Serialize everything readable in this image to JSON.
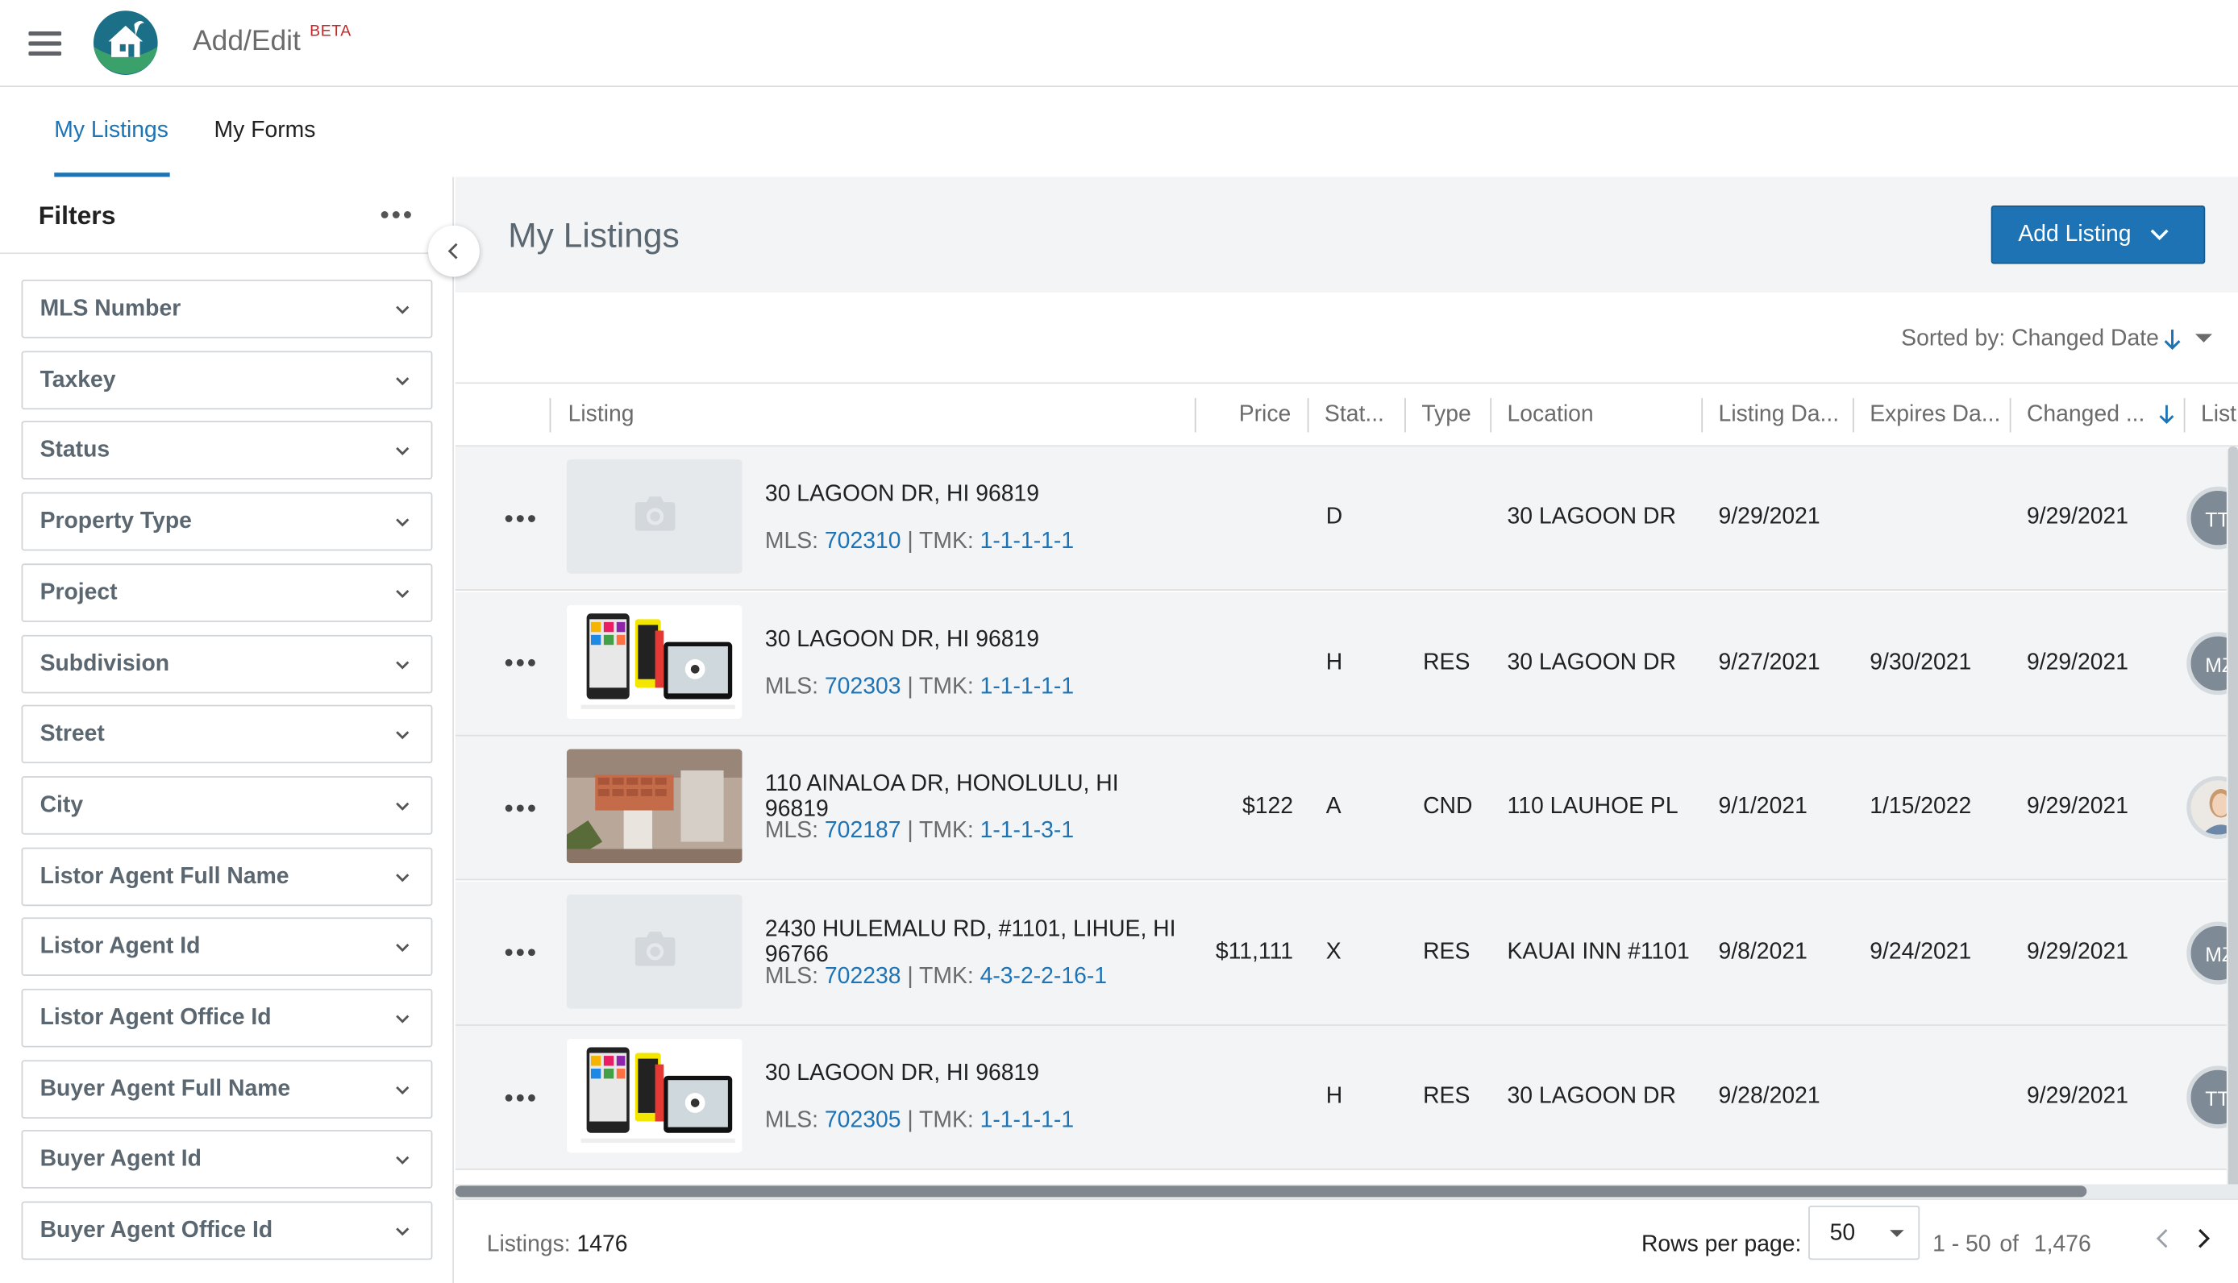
{
  "app": {
    "title": "Add/Edit",
    "badge": "BETA",
    "logo_icon": "house-globe-logo",
    "menu_icon": "hamburger-menu-icon"
  },
  "tabs": [
    {
      "label": "My Listings",
      "active": true
    },
    {
      "label": "My Forms",
      "active": false
    }
  ],
  "sidebar": {
    "title": "Filters",
    "filters": [
      "MLS Number",
      "Taxkey",
      "Status",
      "Property Type",
      "Project",
      "Subdivision",
      "Street",
      "City",
      "Listor Agent Full Name",
      "Listor Agent Id",
      "Listor Agent Office Id",
      "Buyer Agent Full Name",
      "Buyer Agent Id",
      "Buyer Agent Office Id"
    ]
  },
  "main": {
    "title": "My Listings",
    "add_button": "Add Listing",
    "sorted_by": "Sorted by: Changed Date"
  },
  "table": {
    "columns": [
      "Listing",
      "Price",
      "Stat...",
      "Type",
      "Location",
      "Listing Da...",
      "Expires Da...",
      "Changed ...",
      "List"
    ],
    "rows": [
      {
        "address": "30 LAGOON DR, HI 96819",
        "mls_prefix": "MLS: ",
        "mls": "702310",
        "tmk_prefix": " | TMK: ",
        "tmk": "1-1-1-1-1",
        "price": "",
        "status": "D",
        "type": "",
        "location": "30 LAGOON DR",
        "listing_date": "9/29/2021",
        "expires_date": "",
        "changed": "9/29/2021",
        "agent": "TT",
        "photo": "placeholder-camera"
      },
      {
        "address": "30 LAGOON DR, HI 96819",
        "mls_prefix": "MLS: ",
        "mls": "702303",
        "tmk_prefix": " | TMK: ",
        "tmk": "1-1-1-1-1",
        "price": "",
        "status": "H",
        "type": "RES",
        "location": "30 LAGOON DR",
        "listing_date": "9/27/2021",
        "expires_date": "9/30/2021",
        "changed": "9/29/2021",
        "agent": "MZ",
        "photo": "phones"
      },
      {
        "address": "110 AINALOA DR, HONOLULU, HI 96819",
        "mls_prefix": "MLS: ",
        "mls": "702187",
        "tmk_prefix": " | TMK: ",
        "tmk": "1-1-1-3-1",
        "price": "$122",
        "status": "A",
        "type": "CND",
        "location": "110 LAUHOE PL",
        "listing_date": "9/1/2021",
        "expires_date": "1/15/2022",
        "changed": "9/29/2021",
        "agent": "",
        "photo": "house"
      },
      {
        "address": "2430 HULEMALU RD, #1101, LIHUE, HI 96766",
        "mls_prefix": "MLS: ",
        "mls": "702238",
        "tmk_prefix": " | TMK: ",
        "tmk": "4-3-2-2-16-1",
        "price": "$11,111",
        "status": "X",
        "type": "RES",
        "location": "KAUAI INN #1101",
        "listing_date": "9/8/2021",
        "expires_date": "9/24/2021",
        "changed": "9/29/2021",
        "agent": "MZ",
        "photo": "placeholder-camera"
      },
      {
        "address": "30 LAGOON DR, HI 96819",
        "mls_prefix": "MLS: ",
        "mls": "702305",
        "tmk_prefix": " | TMK: ",
        "tmk": "1-1-1-1-1",
        "price": "",
        "status": "H",
        "type": "RES",
        "location": "30 LAGOON DR",
        "listing_date": "9/28/2021",
        "expires_date": "",
        "changed": "9/29/2021",
        "agent": "TT",
        "photo": "phones"
      }
    ]
  },
  "footer": {
    "listings_label": "Listings:",
    "listings_count": "1476",
    "rows_per_page_label": "Rows per page:",
    "rows_per_page": "50",
    "range": "1 - 50",
    "of_label": "of",
    "total": "1,476"
  },
  "colors": {
    "accent": "#1e73b5",
    "header_bg": "#f2f4f6",
    "text_muted": "#6b6b6b"
  }
}
